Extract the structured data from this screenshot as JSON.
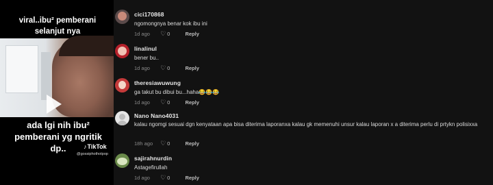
{
  "video": {
    "top_text": "viral..ibu² pemberani selanjut nya",
    "bottom_text": "ada lgi nih ibu² pemberani yg ngritik dp..",
    "brand": "TikTok",
    "handle": "@gossiphothotpop"
  },
  "comments": [
    {
      "username": "cici170868",
      "text": "ngomongnya benar kok ibu ini",
      "age": "1d ago",
      "likes": "0",
      "reply": "Reply",
      "avatar_color": "#5a4a4a"
    },
    {
      "username": "linalinul",
      "text": "bener bu..",
      "age": "1d ago",
      "likes": "0",
      "reply": "Reply",
      "avatar_color": "#b5202a"
    },
    {
      "username": "theresiawuwung",
      "text": "ga takut bu dibui bu...haha😂😂😂",
      "age": "1d ago",
      "likes": "0",
      "reply": "Reply",
      "avatar_color": "#c43a3a"
    },
    {
      "username": "Nano Nano4031",
      "text": "kalau ngomgi sesuai dgn kenyataan apa bisa diterima laporanxa kalau gk memenuhi unsur kalau laporan x a diterima perlu di prtykn polisixxa",
      "age": "18h ago",
      "likes": "0",
      "reply": "Reply",
      "avatar_color": "#e6e6e6"
    },
    {
      "username": "sajirahnurdin",
      "text": "Astagefirullah",
      "age": "1d ago",
      "likes": "0",
      "reply": "Reply",
      "avatar_color": "#6a8a4a"
    }
  ],
  "colors": {
    "background": "#121212",
    "text": "#dcdcdc",
    "muted": "#8a8a8a"
  },
  "icons": {
    "like": "heart-outline-icon",
    "play": "play-icon",
    "brand": "tiktok-note-icon"
  }
}
